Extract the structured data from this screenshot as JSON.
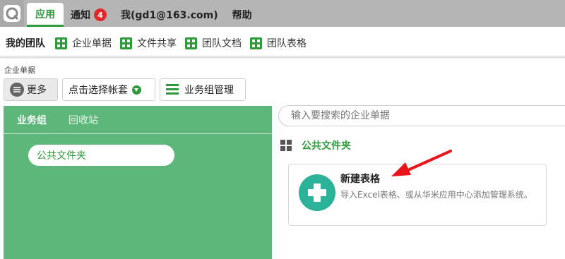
{
  "colors": {
    "accent": "#2e9a3c",
    "panel": "#5eb77a",
    "badge": "#e4292c",
    "plus": "#2bb298",
    "arrow": "#e8141a"
  },
  "topbar": {
    "tabs": [
      {
        "label": "应用",
        "active": true
      },
      {
        "label": "通知",
        "badge": "4"
      },
      {
        "label": "我(gd1@163.com)"
      },
      {
        "label": "帮助"
      }
    ]
  },
  "team": {
    "title": "我的团队",
    "items": [
      {
        "label": "企业单据",
        "icon": "grid-icon"
      },
      {
        "label": "文件共享",
        "icon": "grid-icon"
      },
      {
        "label": "团队文档",
        "icon": "grid-icon"
      },
      {
        "label": "团队表格",
        "icon": "grid-icon"
      }
    ]
  },
  "breadcrumb": "企业单据",
  "toolbar": {
    "more_label": "更多",
    "account_label": "点击选择帐套",
    "group_label": "业务组管理"
  },
  "panel": {
    "tabs": [
      {
        "label": "业务组",
        "active": true
      },
      {
        "label": "回收站"
      }
    ],
    "folder": "公共文件夹"
  },
  "search": {
    "placeholder": "输入要搜索的企业单据"
  },
  "content": {
    "folder_title": "公共文件夹",
    "card": {
      "title": "新建表格",
      "description": "导入Excel表格、或从华米应用中心添加管理系统。"
    }
  }
}
